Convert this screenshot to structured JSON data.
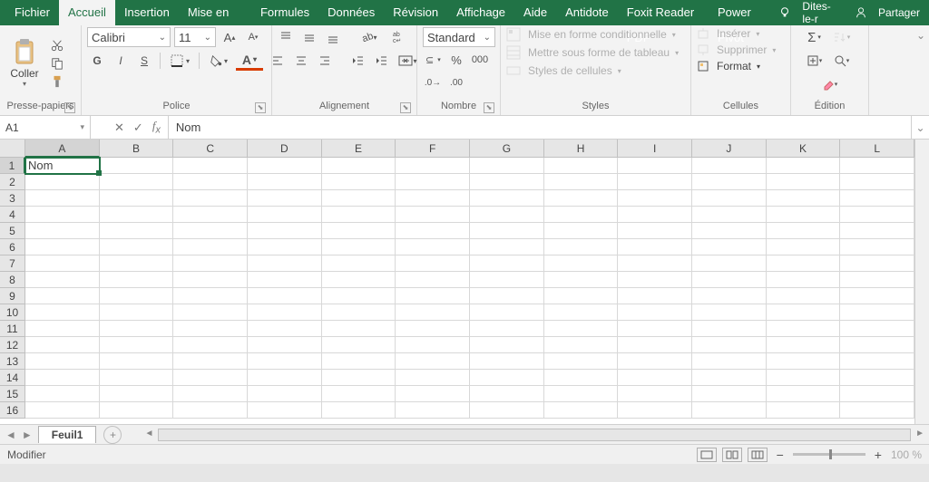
{
  "tabs": [
    "Fichier",
    "Accueil",
    "Insertion",
    "Mise en page",
    "Formules",
    "Données",
    "Révision",
    "Affichage",
    "Aide",
    "Antidote",
    "Foxit Reader PDF",
    "Power Pivot"
  ],
  "active_tab": 1,
  "tell_me": "Dites-le-r",
  "share": "Partager",
  "ribbon": {
    "clipboard": {
      "paste": "Coller",
      "label": "Presse-papiers"
    },
    "font": {
      "name": "Calibri",
      "size": "11",
      "label": "Police",
      "bold": "G",
      "italic": "I",
      "underline": "S"
    },
    "alignment": {
      "label": "Alignement"
    },
    "number": {
      "format": "Standard",
      "label": "Nombre"
    },
    "styles": {
      "conditional": "Mise en forme conditionnelle",
      "table": "Mettre sous forme de tableau",
      "cell": "Styles de cellules",
      "label": "Styles"
    },
    "cells": {
      "insert": "Insérer",
      "delete": "Supprimer",
      "format": "Format",
      "label": "Cellules"
    },
    "editing": {
      "label": "Édition"
    }
  },
  "name_box": "A1",
  "formula": "Nom",
  "columns": [
    "A",
    "B",
    "C",
    "D",
    "E",
    "F",
    "G",
    "H",
    "I",
    "J",
    "K",
    "L"
  ],
  "rows": [
    1,
    2,
    3,
    4,
    5,
    6,
    7,
    8,
    9,
    10,
    11,
    12,
    13,
    14,
    15,
    16
  ],
  "active_cell": {
    "row": 0,
    "col": 0,
    "value": "Nom"
  },
  "sheet": "Feuil1",
  "status": "Modifier",
  "zoom": "100 %"
}
